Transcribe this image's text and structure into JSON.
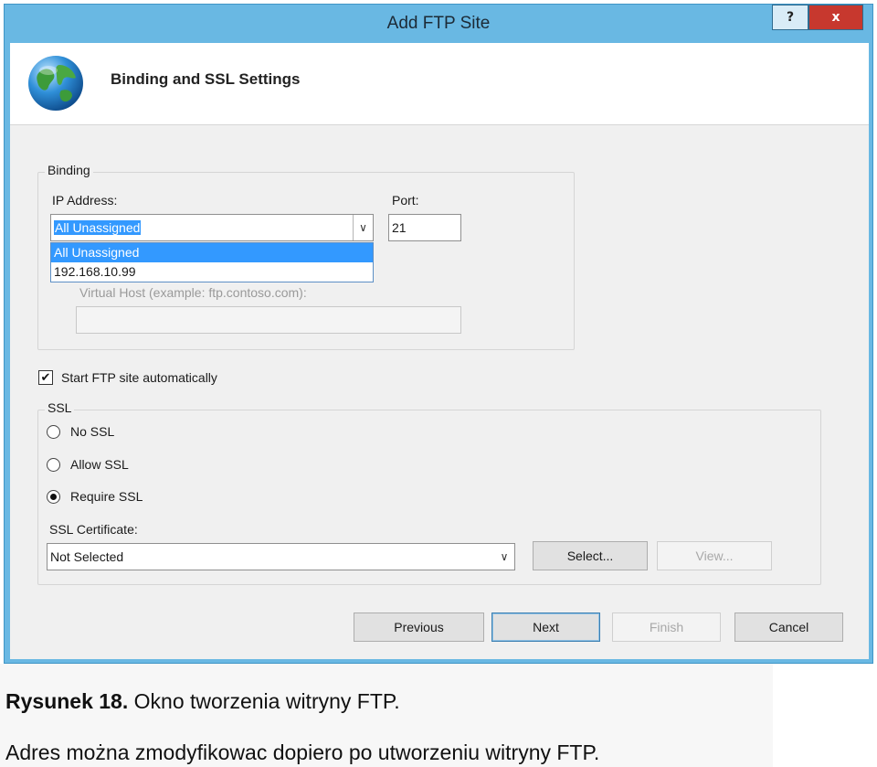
{
  "window": {
    "title": "Add FTP Site",
    "help_label": "?",
    "close_label": "x"
  },
  "header": {
    "icon": "globe-icon",
    "title": "Binding and SSL Settings"
  },
  "binding": {
    "legend": "Binding",
    "ip_label": "IP Address:",
    "ip_value": "All Unassigned",
    "ip_options": [
      "All Unassigned",
      "192.168.10.99"
    ],
    "port_label": "Port:",
    "port_value": "21",
    "virtual_host_label": "Virtual Host (example: ftp.contoso.com):",
    "virtual_host_value": ""
  },
  "start_auto": {
    "label": "Start FTP site automatically",
    "checked": true
  },
  "ssl": {
    "legend": "SSL",
    "options": [
      "No SSL",
      "Allow SSL",
      "Require SSL"
    ],
    "selected": "Require SSL",
    "cert_label": "SSL Certificate:",
    "cert_value": "Not Selected",
    "select_button": "Select...",
    "view_button": "View..."
  },
  "footer": {
    "previous": "Previous",
    "next": "Next",
    "finish": "Finish",
    "cancel": "Cancel"
  },
  "caption": {
    "figure_label": "Rysunek 18.",
    "figure_text": "Okno tworzenia witryny FTP.",
    "line2": "Adres można zmodyfikowac dopiero po utworzeniu witryny FTP."
  },
  "colors": {
    "titlebar": "#69b8e3",
    "close_button": "#c7382e",
    "selection": "#3399ff"
  }
}
